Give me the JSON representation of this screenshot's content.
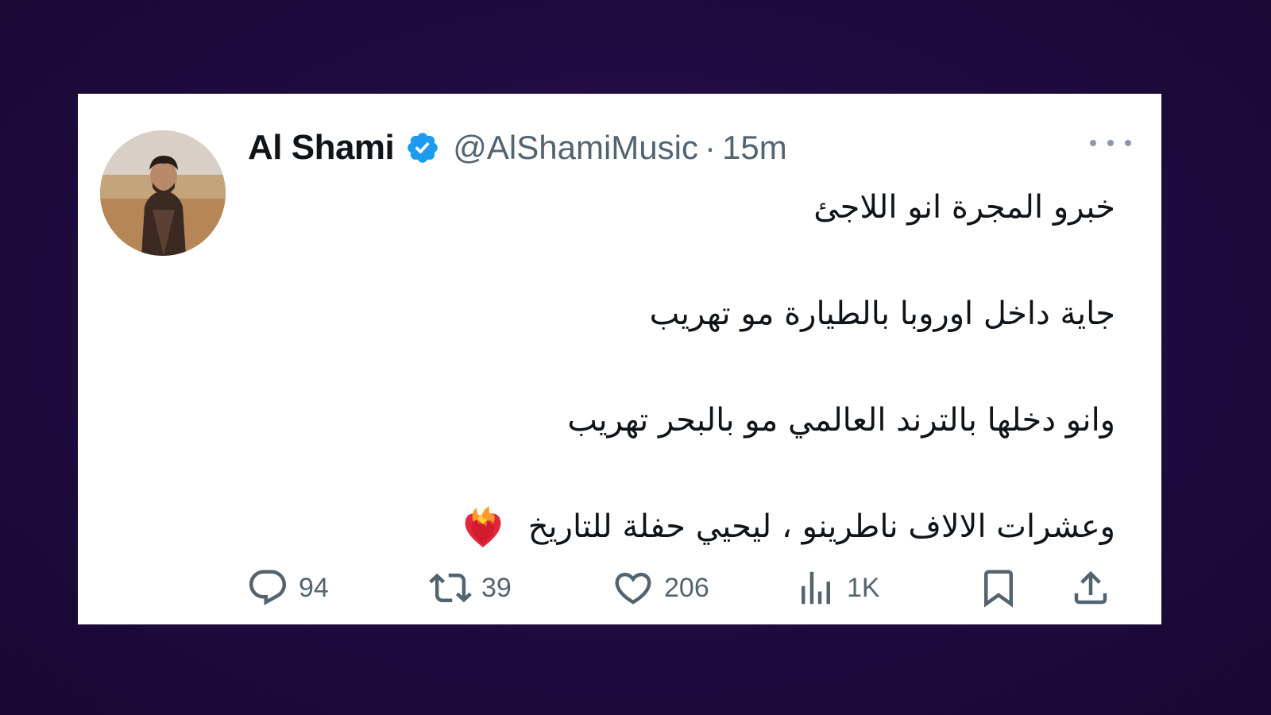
{
  "tweet": {
    "display_name": "Al Shami",
    "handle": "@AlShamiMusic",
    "separator": "·",
    "time": "15m",
    "verified": true,
    "lines": [
      "خبرو المجرة انو اللاجئ",
      "جاية داخل اوروبا بالطيارة مو تهريب",
      "وانو دخلها بالترند العالمي مو بالبحر تهريب",
      "وعشرات الالاف ناطرينو ، ليحيي حفلة للتاريخ"
    ],
    "emoji": "heart-on-fire",
    "metrics": {
      "replies": "94",
      "retweets": "39",
      "likes": "206",
      "views": "1K"
    }
  },
  "colors": {
    "background": "#1f0b3f",
    "card": "#ffffff",
    "text": "#0f1419",
    "muted": "#536471",
    "verified": "#1d9bf0"
  },
  "icons": {
    "more": "more-icon",
    "reply": "reply-icon",
    "retweet": "retweet-icon",
    "like": "like-icon",
    "views": "views-icon",
    "bookmark": "bookmark-icon",
    "share": "share-icon",
    "verified": "verified-badge-icon"
  }
}
